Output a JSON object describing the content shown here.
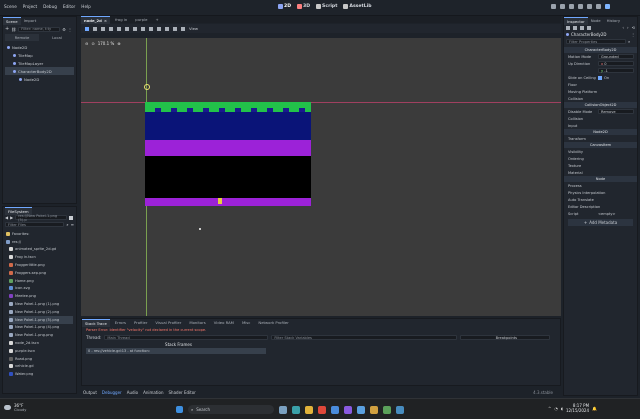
{
  "menu": {
    "items": [
      "Scene",
      "Project",
      "Debug",
      "Editor",
      "Help"
    ]
  },
  "workspaces": [
    "2D",
    "3D",
    "Script",
    "AssetLib"
  ],
  "left_top": {
    "tabs": [
      "Scene",
      "Import"
    ],
    "filter_placeholder": "Filter: name, t:ty",
    "subtabs": [
      "Remote",
      "Local"
    ],
    "tree": [
      {
        "name": "Node2D",
        "indent": 0,
        "color": "#8da5f3"
      },
      {
        "name": "TileMap",
        "indent": 1,
        "color": "#8da5f3"
      },
      {
        "name": "TileMapLayer",
        "indent": 1,
        "color": "#8da5f3"
      },
      {
        "name": "CharacterBody2D",
        "indent": 1,
        "color": "#8da5f3",
        "selected": true
      },
      {
        "name": "Node2D",
        "indent": 2,
        "color": "#8da5f3"
      }
    ]
  },
  "filesystem": {
    "title": "FileSystem",
    "path": "res://New Pokel-1.png (5).p",
    "filter_placeholder": "Filter Files",
    "items": [
      {
        "name": "Favorites:",
        "color": "#e0c060"
      },
      {
        "name": "res://",
        "color": "#7f9cc8"
      },
      {
        "name": "animated_sprite_2d.gd",
        "color": "#d8d8d8"
      },
      {
        "name": "Frog in.tscn",
        "color": "#d8d8d8"
      },
      {
        "name": "Froggerlittle.png",
        "color": "#d06a4a"
      },
      {
        "name": "Froggers.sep.png",
        "color": "#d06a4a"
      },
      {
        "name": "Home.png",
        "color": "#60a060"
      },
      {
        "name": "icon.svg",
        "color": "#5f8fd6"
      },
      {
        "name": "Meelee.png",
        "color": "#8040c0"
      },
      {
        "name": "New Pokel-1.png (1).png",
        "color": "#9aa8c0"
      },
      {
        "name": "New Pokel-1.png (2).png",
        "color": "#9aa8c0"
      },
      {
        "name": "New Pokel-1.png (5).png",
        "color": "#9aa8c0",
        "selected": true
      },
      {
        "name": "New Pokel-1.png (4).png",
        "color": "#9aa8c0"
      },
      {
        "name": "New Pokel-1.png.png",
        "color": "#9aa8c0"
      },
      {
        "name": "node_2d.tscn",
        "color": "#d8d8d8"
      },
      {
        "name": "purple.tscn",
        "color": "#d8d8d8"
      },
      {
        "name": "Road.png",
        "color": "#606060"
      },
      {
        "name": "vehicle.gd",
        "color": "#d8d8d8"
      },
      {
        "name": "Water.png",
        "color": "#3050c0"
      }
    ]
  },
  "center": {
    "scene_tab": "node_2d",
    "other_tabs": [
      "frog in",
      "purple"
    ],
    "toolbar_view": "View",
    "zoom": "170.1 %"
  },
  "bottom": {
    "tabs": [
      "Stack Trace",
      "Errors",
      "Profiler",
      "Visual Profiler",
      "Monitors",
      "Video RAM",
      "Misc",
      "Network Profiler"
    ],
    "error_text": "Parser Error: Identifier \"velocity\" not declared in the current scope.",
    "thread_label": "Thread:",
    "thread_value": "Main Thread",
    "stack_title": "Stack Frames",
    "stack_item": "0 - res://vehicle.gd:13 - at function:",
    "filter_placeholder": "Filter Stack Variables",
    "breakpoints": "Breakpoints",
    "status_tabs": [
      "Output",
      "Debugger",
      "Audio",
      "Animation",
      "Shader Editor"
    ],
    "version": "4.3.stable"
  },
  "inspector": {
    "tabs": [
      "Inspector",
      "Node",
      "History"
    ],
    "object": "CharacterBody2D",
    "filter_placeholder": "Filter Properties",
    "class_header": "CharacterBody2D",
    "motion_mode_label": "Motion Mode",
    "motion_mode_value": "Grounded",
    "up_direction_label": "Up Direction",
    "up_x": "0",
    "up_y": "-1",
    "slide_label": "Slide on Ceiling",
    "slide_value": "On",
    "groups": [
      "Floor",
      "Moving Platform",
      "Collision"
    ],
    "co_header": "CollisionObject2D",
    "disable_mode_label": "Disable Mode",
    "disable_mode_value": "Remove",
    "groups2": [
      "Collision",
      "Input"
    ],
    "node2d_header": "Node2D",
    "groups3": [
      "Transform"
    ],
    "canvas_header": "CanvasItem",
    "groups4": [
      "Visibility",
      "Ordering",
      "Texture",
      "Material"
    ],
    "node_header": "Node",
    "groups5": [
      "Process",
      "Physics Interpolation",
      "Auto Translate",
      "Editor Description"
    ],
    "script_label": "Script",
    "script_value": "<empty>",
    "add_metadata": "Add Metadata"
  },
  "taskbar": {
    "temp": "36°F",
    "weather": "Cloudy",
    "search": "Search",
    "time": "8:17 PM",
    "date": "12/15/2024"
  },
  "colors": {
    "accent": "#70a8ff",
    "selection": "#37404c",
    "godot_blue": "#478cbf",
    "error": "#ff786b"
  }
}
